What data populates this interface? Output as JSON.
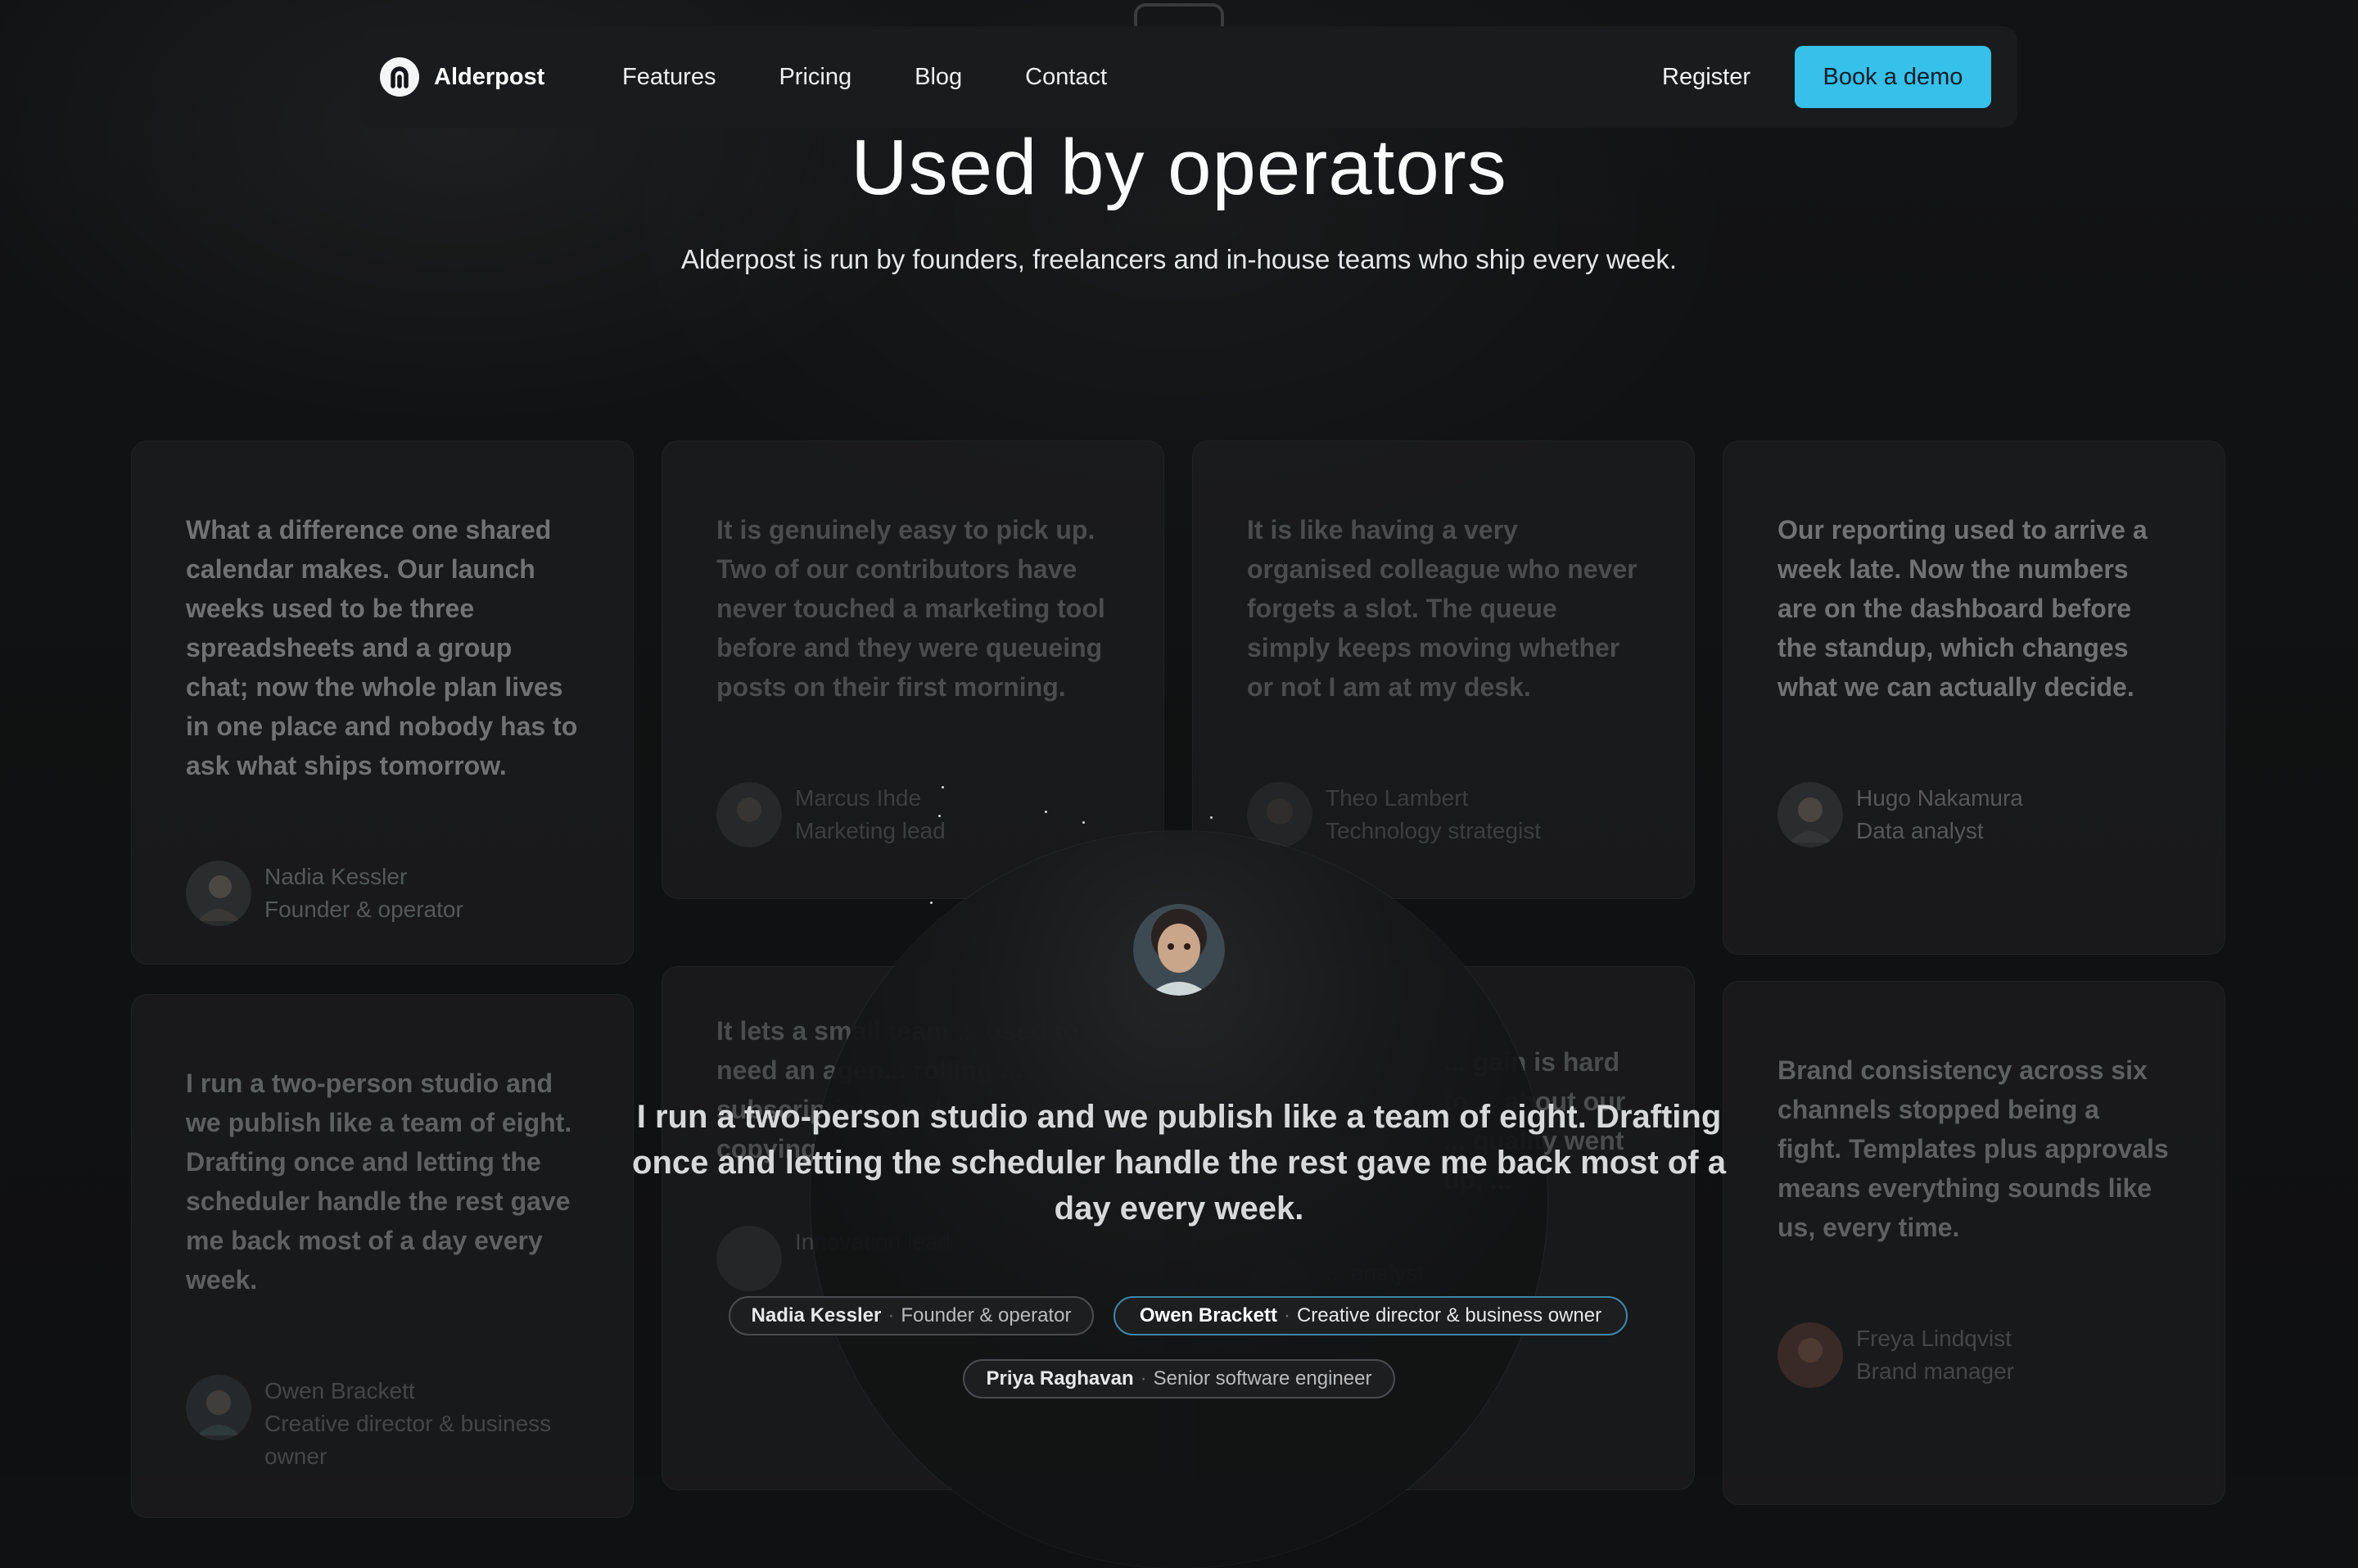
{
  "nav": {
    "brand": "Alderpost",
    "links": [
      "Features",
      "Pricing",
      "Blog",
      "Contact"
    ],
    "register": "Register",
    "cta": "Book a demo"
  },
  "hero": {
    "title": "Used by operators",
    "subtitle": "Alderpost is run by founders, freelancers and in-house teams who ship every week."
  },
  "testimonials": [
    {
      "quote": "What a difference one shared calendar makes. Our launch weeks used to be three spreadsheets and a group chat; now the whole plan lives in one place and nobody has to ask what ships tomorrow.",
      "name": "Nadia Kessler",
      "role": "Founder & operator"
    },
    {
      "quote": "It is genuinely easy to pick up. Two of our contributors have never touched a marketing tool before and they were queueing posts on their first morning.",
      "name": "Marcus Ihde",
      "role": "Marketing lead"
    },
    {
      "quote": "It is like having a very organised colleague who never forgets a slot. The queue simply keeps moving whether or not I am at my desk.",
      "name": "Theo Lambert",
      "role": "Technology strategist"
    },
    {
      "quote": "Our reporting used to arrive a week late. Now the numbers are on the dashboard before the standup, which changes what we can actually decide.",
      "name": "Hugo Nakamura",
      "role": "Data analyst"
    },
    {
      "quote": "I run a two-person studio and we publish like a team of eight. Drafting once and letting the scheduler handle the rest gave me back most of a day every week.",
      "name": "Owen Brackett",
      "role": "Creative director & business owner"
    },
    {
      "quote": "It lets a small team ... used to need an agen... rolling ... subscriptions and a... manual copying.",
      "name": "",
      "role": "Innovation lead"
    },
    {
      "quote": "... gain is hard to ... about our ... quality went up, ...",
      "name": "",
      "role": "... analyst"
    },
    {
      "quote": "Brand consistency across six channels stopped being a fight. Templates plus approvals means everything sounds like us, every time.",
      "name": "Freya Lindqvist",
      "role": "Brand manager"
    }
  ],
  "featured": {
    "quote": "I run a two-person studio and we publish like a team of eight. Drafting once and letting the scheduler handle the rest gave me back most of a day every week.",
    "pills": [
      {
        "name": "Nadia Kessler",
        "role": "Founder & operator",
        "active": false
      },
      {
        "name": "Owen Brackett",
        "role": "Creative director & business owner",
        "active": true
      },
      {
        "name": "Priya Raghavan",
        "role": "Senior software engineer",
        "active": false
      }
    ]
  },
  "colors": {
    "accent": "#36c0ea",
    "background": "#101112",
    "nav": "#1a1b1c"
  }
}
